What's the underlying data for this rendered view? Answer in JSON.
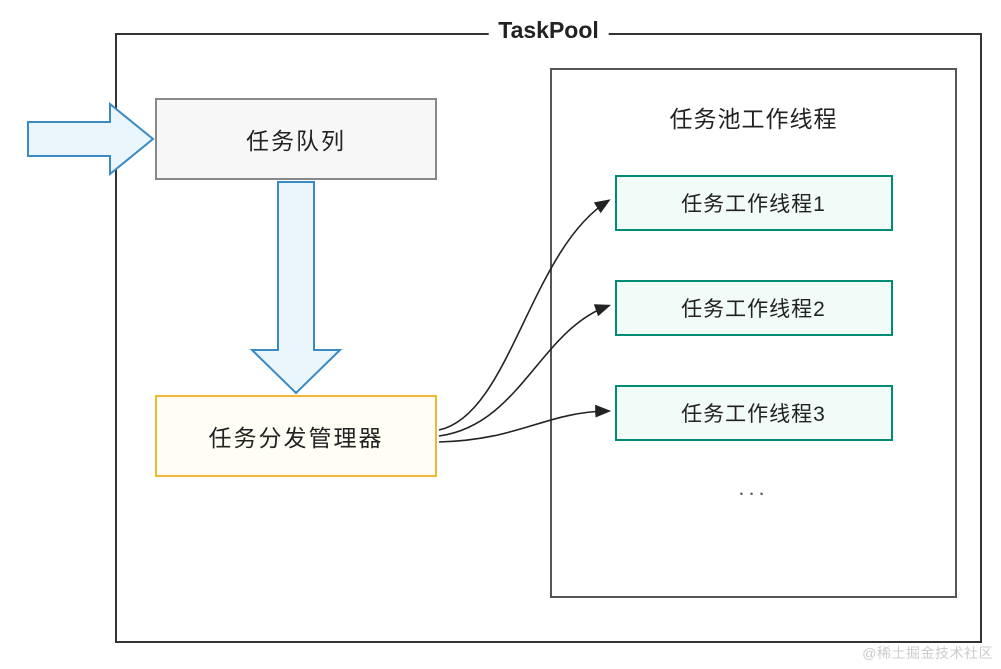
{
  "title": "TaskPool",
  "taskQueue": {
    "label": "任务队列"
  },
  "dispatcher": {
    "label": "任务分发管理器"
  },
  "workerPool": {
    "title": "任务池工作线程",
    "threads": [
      "任务工作线程1",
      "任务工作线程2",
      "任务工作线程3"
    ],
    "ellipsis": "..."
  },
  "watermark": "@稀土掘金技术社区",
  "colors": {
    "arrowFill": "#eaf6fc",
    "arrowStroke": "#3a8ac6",
    "curveStroke": "#222222",
    "queueBorder": "#888888",
    "dispatcherBorder": "#f2b736",
    "workerBorder": "#008c74"
  }
}
